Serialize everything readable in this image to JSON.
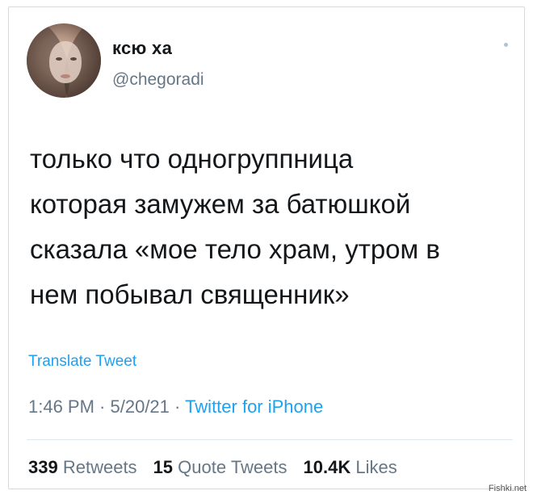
{
  "user": {
    "name": "ксю ха",
    "handle": "@chegoradi"
  },
  "tweet": {
    "lines": [
      "только что одногруппница",
      "которая замужем за батюшкой",
      "сказала «мое тело храм, утром в",
      "нем побывал священник»"
    ],
    "translate_label": "Translate Tweet",
    "time": "1:46 PM",
    "date": "5/20/21",
    "separator": " · ",
    "source": "Twitter for iPhone"
  },
  "stats": {
    "retweets_count": "339",
    "retweets_label": "Retweets",
    "quotes_count": "15",
    "quotes_label": "Quote Tweets",
    "likes_count": "10.4K",
    "likes_label": "Likes"
  },
  "watermark": "Fishki.net",
  "colors": {
    "link": "#1da1f2",
    "muted": "#657786",
    "text": "#14171a"
  },
  "icons": {
    "more": "more-dot-icon"
  }
}
